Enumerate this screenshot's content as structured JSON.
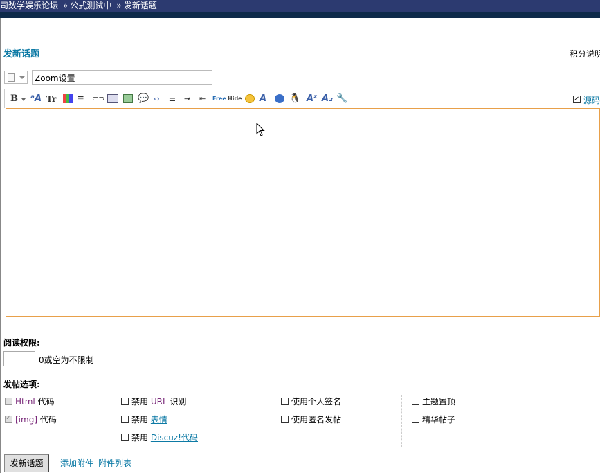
{
  "breadcrumb": {
    "items": [
      "司数学娱乐论坛",
      "公式测试中",
      "发新话题"
    ],
    "separator": "»"
  },
  "page": {
    "title": "发新话题",
    "side_link": "积分说明"
  },
  "subject": {
    "value": "Zoom设置"
  },
  "toolbar": {
    "items": [
      "bold-icon",
      "font-size-icon",
      "font-face-icon",
      "color-icon",
      "align-icon",
      "link-icon",
      "email-icon",
      "image-icon",
      "quote-icon",
      "code-icon",
      "ordered-list-icon",
      "indent-icon",
      "outdent-icon",
      "free-icon",
      "hide-icon",
      "smiley-icon",
      "font-a-icon",
      "flash-icon",
      "qq-icon",
      "superscript-icon",
      "subscript-icon",
      "wrench-icon"
    ],
    "bold_label": "B",
    "tr_label": "Tr",
    "free_label": "Free",
    "hide_label": "Hide",
    "source_mode_label": "源码",
    "source_mode_checked": true
  },
  "permission": {
    "label": "阅读权限:",
    "value": "",
    "hint": "0或空为不限制"
  },
  "options": {
    "label": "发帖选项:",
    "html_code_kw": "Html",
    "html_code_suffix": " 代码",
    "img_code_kw": "[img]",
    "img_code_suffix": " 代码",
    "disable_prefix": "禁用",
    "url_kw": "URL",
    "url_suffix": " 识别",
    "smiley_link": "表情",
    "discuz_link": "Discuz!代码",
    "signature": "使用个人签名",
    "anonymous": "使用匿名发帖",
    "sticky": "主题置顶",
    "digest": "精华帖子"
  },
  "footer": {
    "submit": "发新话题",
    "add_attachment": "添加附件",
    "attachment_list": "附件列表"
  },
  "colors": {
    "accent": "#0d7aa5",
    "editor_border": "#e8a04a",
    "topbar": "#2c3a70"
  }
}
